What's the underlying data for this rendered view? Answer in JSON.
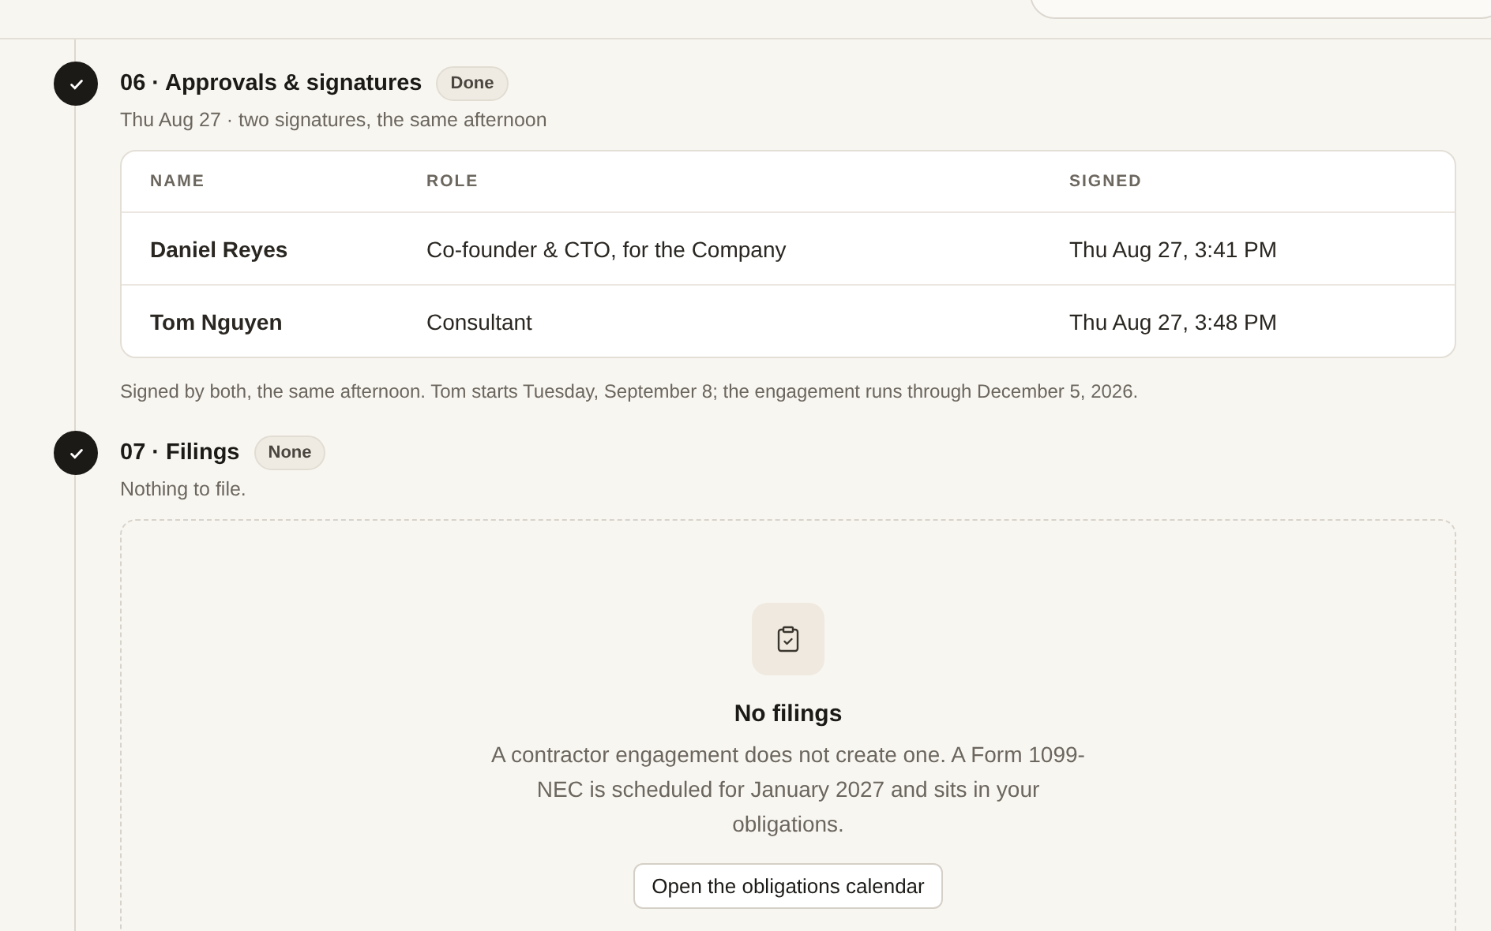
{
  "steps": [
    {
      "kind": "table",
      "done": true,
      "title": "06 · Approvals & signatures",
      "badge": "Done",
      "subtitle": "Thu Aug 27 · two signatures, the same afternoon",
      "table": {
        "columns": [
          "NAME",
          "ROLE",
          "SIGNED"
        ],
        "rows": [
          [
            "Daniel Reyes",
            "Co-founder & CTO, for the Company",
            "Thu Aug 27, 3:41 PM"
          ],
          [
            "Tom Nguyen",
            "Consultant",
            "Thu Aug 27, 3:48 PM"
          ]
        ]
      },
      "note": "Signed by both, the same afternoon. Tom starts Tuesday, September 8; the engagement runs through December 5, 2026."
    },
    {
      "kind": "empty",
      "done": true,
      "title": "07 · Filings",
      "badge": "None",
      "subtitle": "Nothing to file.",
      "empty": {
        "heading": "No filings",
        "text": "A contractor engagement does not create one. A Form 1099-NEC is scheduled for January 2027 and sits in your obligations.",
        "button": "Open the obligations calendar"
      }
    }
  ]
}
